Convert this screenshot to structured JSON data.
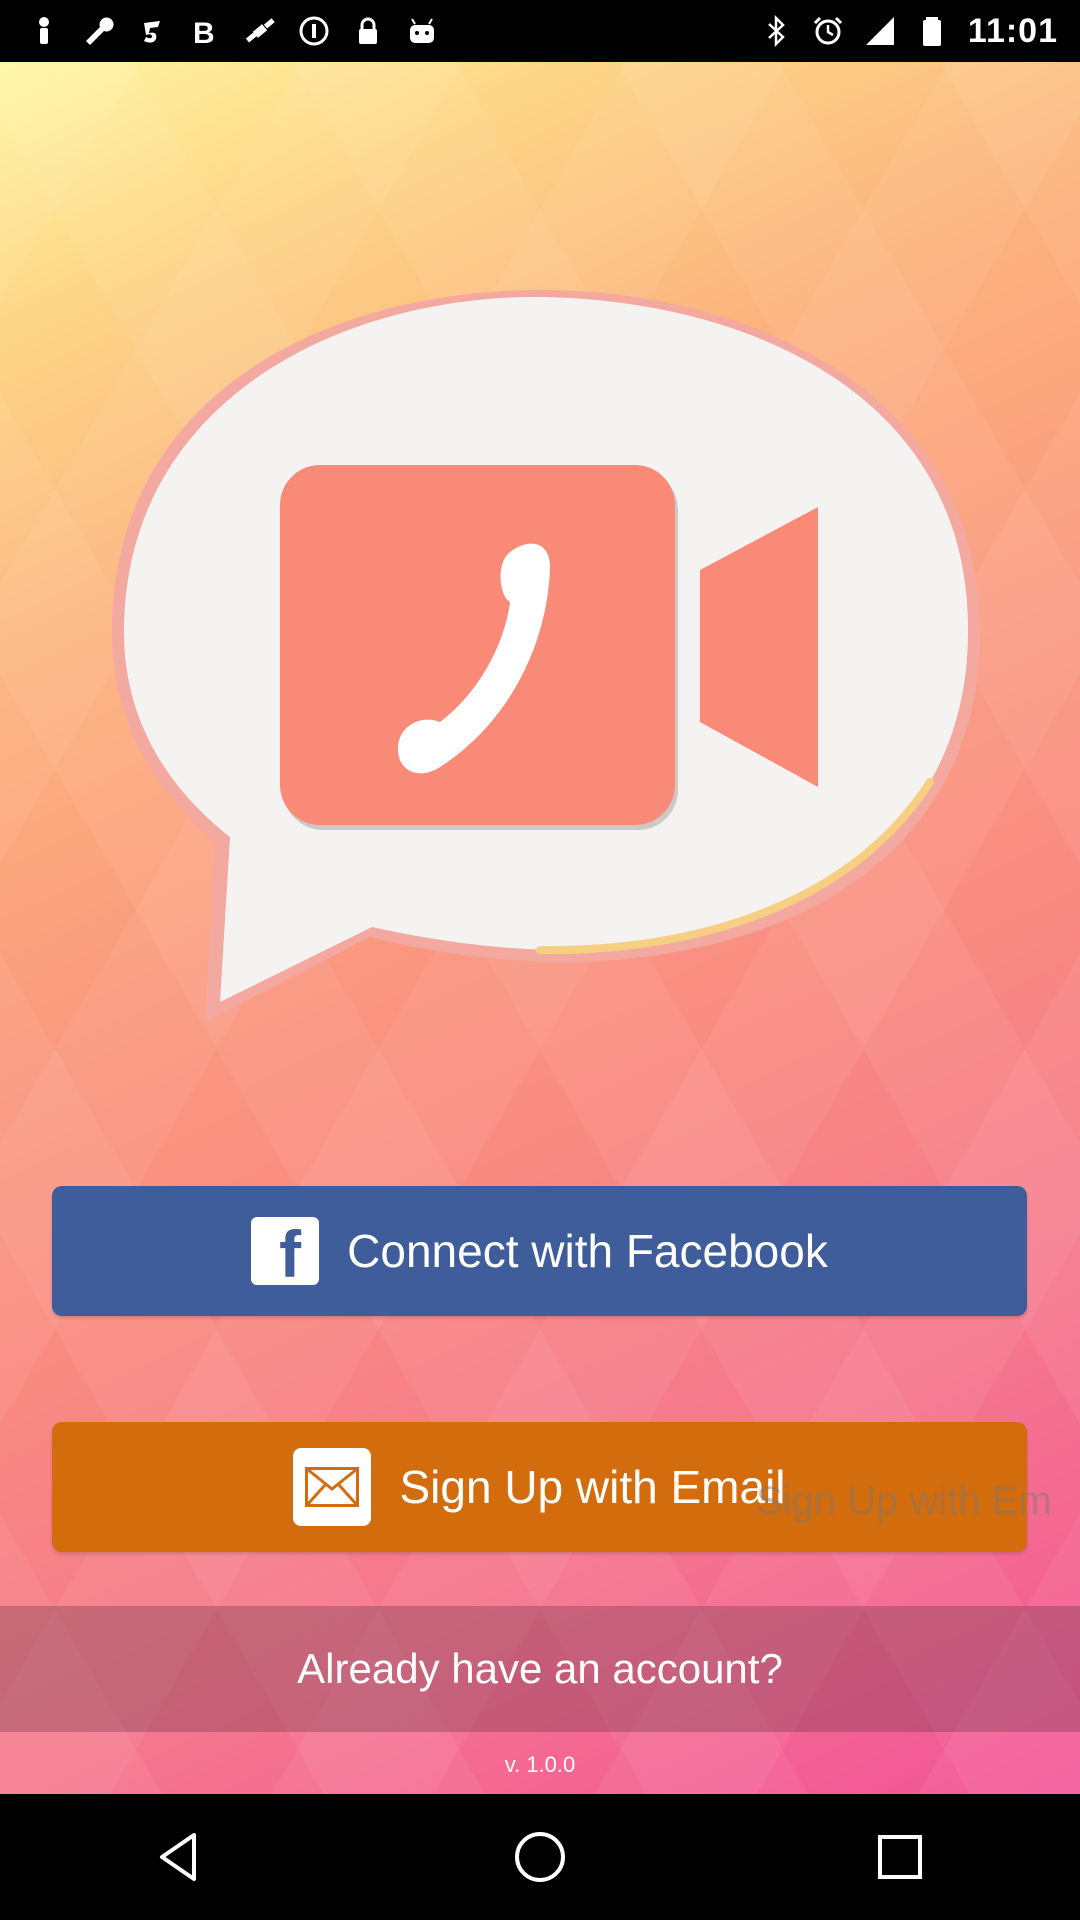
{
  "status_bar": {
    "time": "11:01",
    "left_icons": [
      "notification-icon",
      "wrench-icon",
      "music-icon",
      "bold-b-icon",
      "fake-gps-icon",
      "info-icon",
      "lock-icon",
      "android-icon"
    ],
    "right_icons": [
      "bluetooth-icon",
      "alarm-icon",
      "signal-icon",
      "battery-icon"
    ]
  },
  "logo": {
    "icon": "video-call-icon",
    "accent": "#f98a78"
  },
  "buttons": {
    "facebook_label": "Connect with Facebook",
    "facebook_icon_glyph": "f",
    "email_label": "Sign Up with Email",
    "email_ghost_label": "Sign Up with Em"
  },
  "login_prompt": "Already have an account?",
  "version": "v. 1.0.0",
  "colors": {
    "facebook": "#3f5d9b",
    "email": "#d36c0d"
  }
}
